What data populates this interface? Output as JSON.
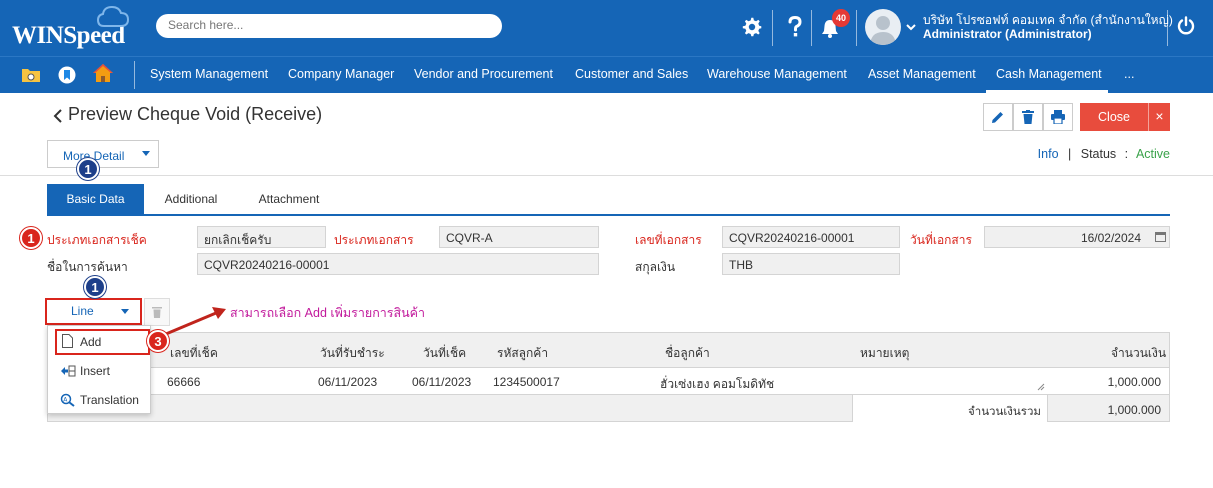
{
  "app": {
    "logo_text": "WINSpeed",
    "search_placeholder": "Search here...",
    "notification_count": "40",
    "company": "บริษัท โปรซอฟท์ คอมเทค จำกัด (สำนักงานใหญ่)",
    "user": "Administrator (Administrator)"
  },
  "nav": {
    "items": [
      "System Management",
      "Company Manager",
      "Vendor and Procurement",
      "Customer and Sales",
      "Warehouse Management",
      "Asset Management",
      "Cash Management",
      "..."
    ],
    "active_index": 6
  },
  "page": {
    "title": "Preview Cheque Void (Receive)",
    "close_label": "Close",
    "close_x": "×",
    "more_detail": "More Detail",
    "info_label": "Info",
    "status_label": "Status",
    "status_sep": ":",
    "status_value": "Active"
  },
  "tabs": [
    "Basic Data",
    "Additional",
    "Attachment"
  ],
  "form": {
    "cheque_doc_type_label": "ประเภทเอกสารเช็ค",
    "cheque_doc_type_value": "ยกเลิกเช็ครับ",
    "doc_type_label": "ประเภทเอกสาร",
    "doc_type_value": "CQVR-A",
    "doc_no_label": "เลขที่เอกสาร",
    "doc_no_value": "CQVR20240216-00001",
    "doc_date_label": "วันที่เอกสาร",
    "doc_date_value": "16/02/2024",
    "search_name_label": "ชื่อในการค้นหา",
    "search_name_value": "CQVR20240216-00001",
    "currency_label": "สกุลเงิน",
    "currency_value": "THB"
  },
  "line_menu": {
    "button_label": "Line",
    "items": [
      "Add",
      "Insert",
      "Translation"
    ],
    "hint": "สามารถเลือก Add เพิ่มรายการสินค้า"
  },
  "grid": {
    "columns": [
      "เลขที่เช็ค",
      "วันที่รับชำระ",
      "วันที่เช็ค",
      "รหัสลูกค้า",
      "ชื่อลูกค้า",
      "หมายเหตุ",
      "จำนวนเงิน"
    ],
    "rows": [
      [
        "66666",
        "06/11/2023",
        "06/11/2023",
        "1234500017",
        "ฮั่วเซ่งเฮง คอมโมดิทัช",
        "",
        "1,000.000"
      ]
    ],
    "total_label": "จำนวนเงินรวม",
    "total_value": "1,000.000"
  },
  "markers": {
    "m1a": "1",
    "m1b": "1",
    "m1c": "1",
    "m3": "3"
  },
  "colors": {
    "brand": "#1565b6",
    "danger": "#e84c3d",
    "required": "#d9251c",
    "active_status": "#3aa24a",
    "hint": "#c21a9c"
  }
}
